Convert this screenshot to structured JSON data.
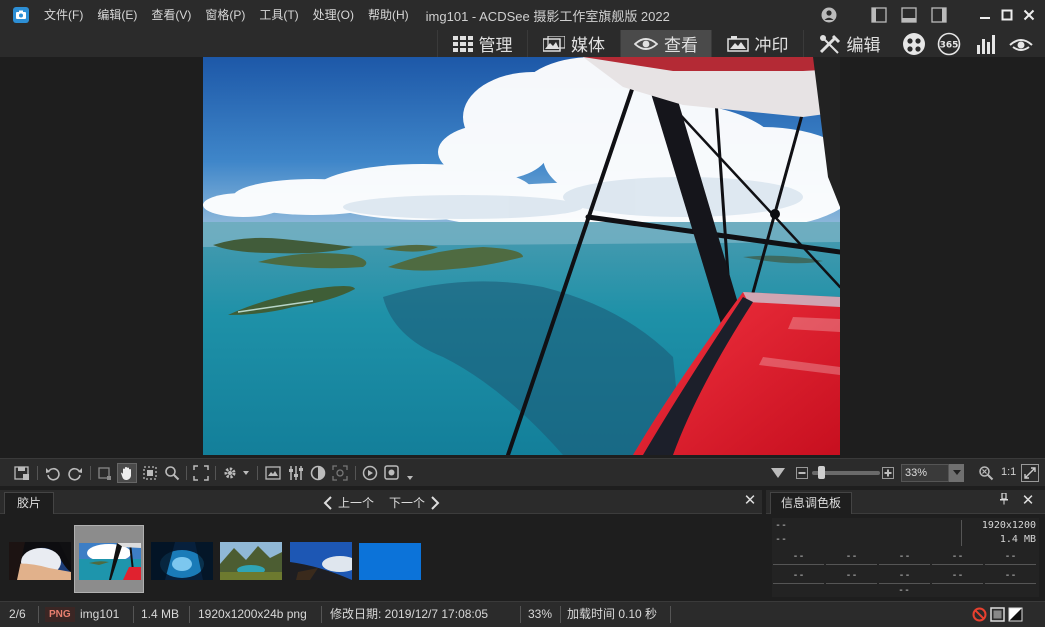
{
  "window": {
    "title": "img101 - ACDSee 摄影工作室旗舰版 2022"
  },
  "menu": [
    {
      "label": "文件(F)"
    },
    {
      "label": "编辑(E)"
    },
    {
      "label": "查看(V)"
    },
    {
      "label": "窗格(P)"
    },
    {
      "label": "工具(T)"
    },
    {
      "label": "处理(O)"
    },
    {
      "label": "帮助(H)"
    }
  ],
  "modes": [
    {
      "label": "管理",
      "icon": "grid-icon",
      "active": false
    },
    {
      "label": "媒体",
      "icon": "media-icon",
      "active": false
    },
    {
      "label": "查看",
      "icon": "eye-icon",
      "active": true
    },
    {
      "label": "冲印",
      "icon": "develop-icon",
      "active": false
    },
    {
      "label": "编辑",
      "icon": "edit-tools-icon",
      "active": false
    }
  ],
  "mode_extra_icons": [
    "people-icon",
    "acdsee-365-icon",
    "dashboard-icon",
    "luminous-eye-icon"
  ],
  "viewer_toolbar": {
    "zoom_value": "33%",
    "actual_size_label": "1:1"
  },
  "filmstrip": {
    "tab_label": "胶片",
    "prev_label": "上一个",
    "next_label": "下一个",
    "selected_index": 1,
    "thumbnail_count": 6
  },
  "info_palette": {
    "tab_label": "信息调色板",
    "row1_left": "--",
    "row1_right": "1920x1200",
    "row2_left": "--",
    "row2_right": "1.4 MB",
    "grid_row1": [
      "--",
      "--",
      "--",
      "--",
      "--"
    ],
    "grid_row2": [
      "--",
      "--",
      "--",
      "--",
      "--"
    ],
    "bottom": "--"
  },
  "status": {
    "position": "2/6",
    "format": "PNG",
    "filename": "img101",
    "filesize": "1.4 MB",
    "dimensions": "1920x1200x24b png",
    "modified": "修改日期: 2019/12/7 17:08:05",
    "zoom": "33%",
    "load_time": "加载时间 0.10 秒"
  },
  "colors": {
    "background": "#1e1e1e",
    "chrome": "#2b2b2b",
    "active_mode": "#4a4a4a",
    "accent_blue": "#2d8fd5",
    "png_badge_text": "#e87f6f"
  }
}
